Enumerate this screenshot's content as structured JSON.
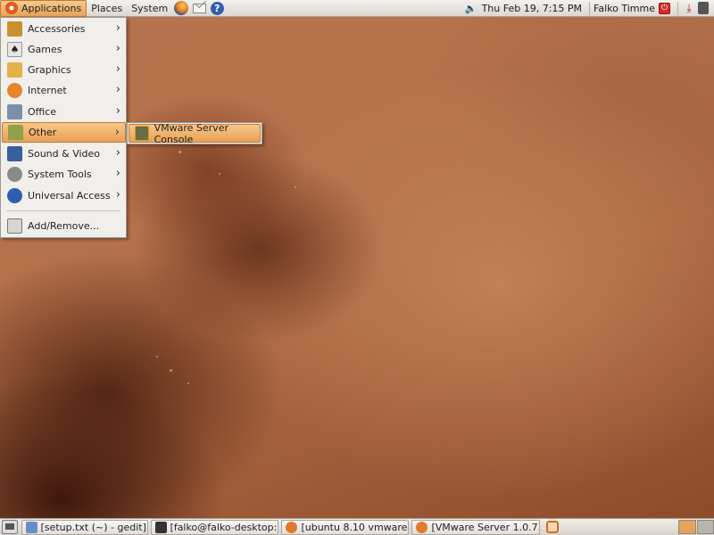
{
  "top_panel": {
    "menus": [
      "Applications",
      "Places",
      "System"
    ],
    "launchers": [
      "firefox-icon",
      "mail-icon",
      "help-icon"
    ],
    "clock": "Thu Feb 19,  7:15 PM",
    "user": "Falko Timme"
  },
  "apps_menu": {
    "items": [
      {
        "label": "Accessories",
        "icon": "accessories-icon",
        "color": "#c9912e"
      },
      {
        "label": "Games",
        "icon": "games-icon",
        "color": "#e8e6e2"
      },
      {
        "label": "Graphics",
        "icon": "graphics-icon",
        "color": "#e3b24a"
      },
      {
        "label": "Internet",
        "icon": "internet-icon",
        "color": "#e8842a"
      },
      {
        "label": "Office",
        "icon": "office-icon",
        "color": "#7c8fa8"
      },
      {
        "label": "Other",
        "icon": "other-icon",
        "color": "#8fa24a"
      },
      {
        "label": "Sound & Video",
        "icon": "sound-video-icon",
        "color": "#3a5fa0"
      },
      {
        "label": "System Tools",
        "icon": "system-tools-icon",
        "color": "#8a8a8a"
      },
      {
        "label": "Universal Access",
        "icon": "universal-access-icon",
        "color": "#2d5fb0"
      }
    ],
    "add_remove": "Add/Remove..."
  },
  "other_submenu": {
    "items": [
      {
        "label": "VMware Server Console",
        "icon": "vmware-icon"
      }
    ]
  },
  "taskbar": {
    "tasks": [
      {
        "label": "[setup.txt (~) - gedit]",
        "icon": "gedit-icon",
        "color": "#6a8cc7"
      },
      {
        "label": "[falko@falko-desktop:...",
        "icon": "terminal-icon",
        "color": "#333333"
      },
      {
        "label": "[ubuntu 8.10 vmware...",
        "icon": "firefox-icon",
        "color": "#e07a2a"
      },
      {
        "label": "[VMware Server 1.0.7...",
        "icon": "firefox-icon",
        "color": "#e07a2a"
      }
    ]
  },
  "colors": {
    "highlight": "#eaa055",
    "panel": "#e6e2dc",
    "wallpaper": "#b4714a"
  }
}
